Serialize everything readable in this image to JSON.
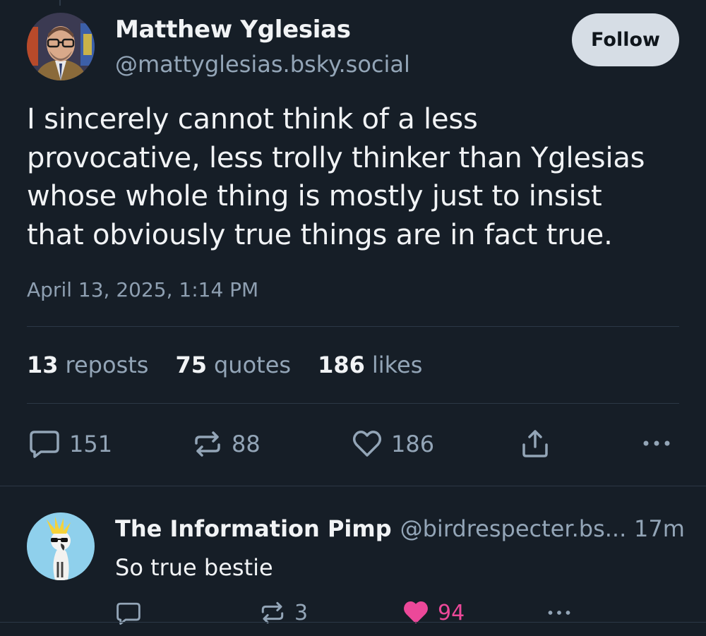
{
  "post": {
    "author": {
      "name": "Matthew Yglesias",
      "handle": "@mattyglesias.bsky.social"
    },
    "follow_label": "Follow",
    "text_lines": [
      "I sincerely cannot think of a less",
      "provocative, less trolly thinker than Yglesias",
      "whose whole thing is mostly just to insist",
      "that obviously true things are in fact true."
    ],
    "timestamp": "April 13, 2025, 1:14 PM",
    "stats": [
      {
        "count": "13",
        "label": "reposts"
      },
      {
        "count": "75",
        "label": "quotes"
      },
      {
        "count": "186",
        "label": "likes"
      }
    ],
    "actions": {
      "replies": "151",
      "reposts": "88",
      "likes": "186",
      "share_icon": "share-icon",
      "more_icon": "more-icon"
    }
  },
  "reply": {
    "author": {
      "name": "The Information Pimp",
      "handle": "@birdrespecter.bs..."
    },
    "time": "17m",
    "text": "So true bestie",
    "actions": {
      "replies": "",
      "reposts": "3",
      "likes": "94"
    }
  },
  "colors": {
    "background": "#161e27",
    "text": "#f1f3f5",
    "muted": "#93a5b7",
    "follow_bg": "#d6dde5",
    "like_active": "#ec4899"
  }
}
